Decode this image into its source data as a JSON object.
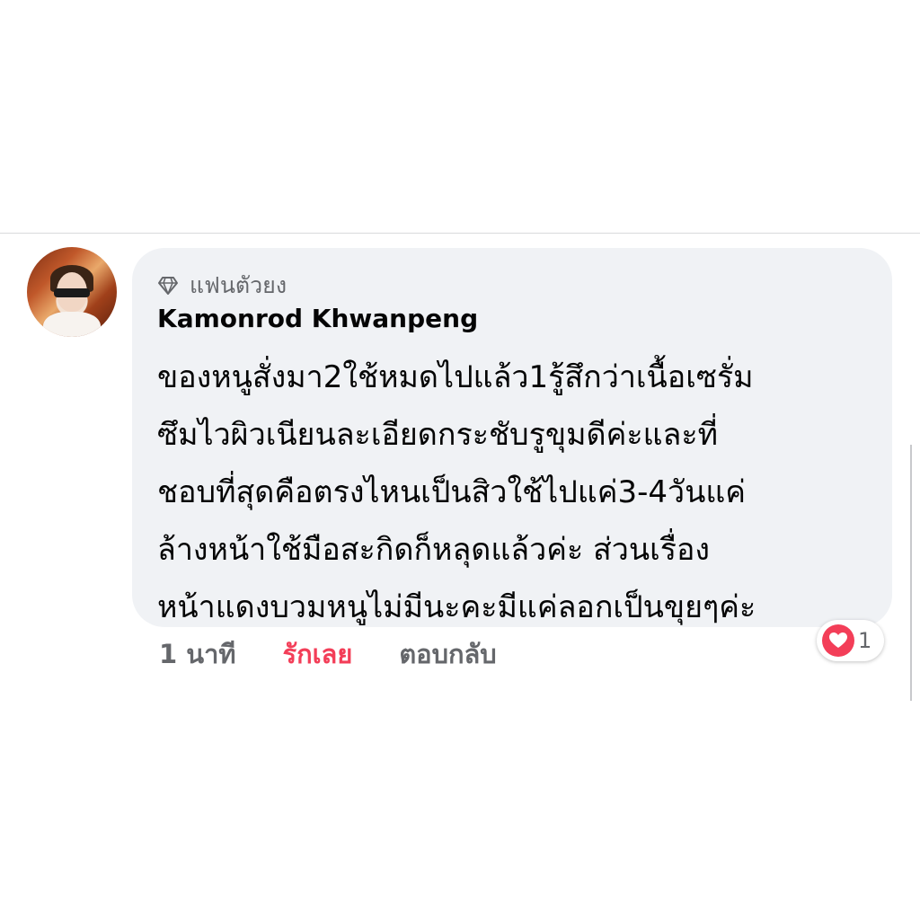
{
  "comment": {
    "badge_label": "แฟนตัวยง",
    "author": "Kamonrod Khwanpeng",
    "text_lines": [
      "ของหนูสั่งมา2ใช้หมดไปแล้ว1รู้สึกว่าเนื้อเซรั่ม",
      "ซึมไวผิวเนียนละเอียดกระชับรูขุมดีค่ะและที่",
      "ชอบที่สุดคือตรงไหนเป็นสิวใช้ไปแค่3-4วันแค่",
      "ล้างหน้าใช้มือสะกิดก็หลุดแล้วค่ะ ส่วนเรื่อง",
      "หน้าแดงบวมหนูไม่มีนะคะมีแค่ลอกเป็นขุยๆค่ะ"
    ],
    "timestamp": "1 นาที",
    "love_label": "รักเลย",
    "reply_label": "ตอบกลับ",
    "reaction_count": "1"
  },
  "icons": {
    "badge": "diamond-icon",
    "reaction": "heart-icon"
  },
  "colors": {
    "bubble_bg": "#f0f2f5",
    "love_accent": "#f33e58",
    "muted_text": "#65676b",
    "primary_text": "#050505"
  }
}
